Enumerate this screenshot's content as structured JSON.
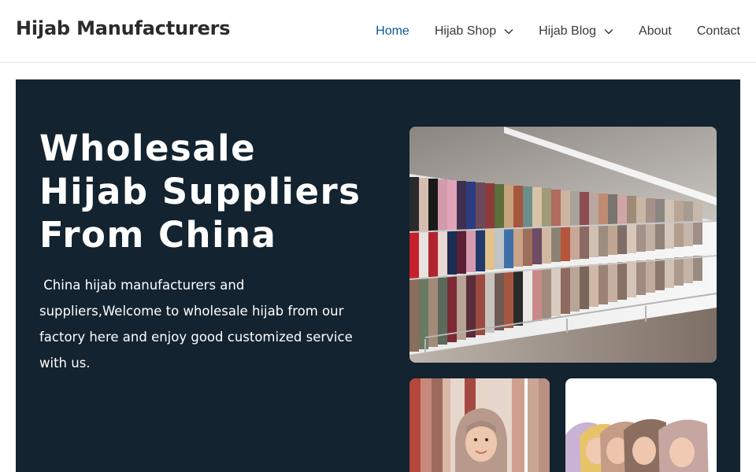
{
  "header": {
    "site_title": "Hijab Manufacturers",
    "nav": [
      {
        "label": "Home",
        "active": true,
        "has_dropdown": false
      },
      {
        "label": "Hijab Shop",
        "active": false,
        "has_dropdown": true
      },
      {
        "label": "Hijab Blog",
        "active": false,
        "has_dropdown": true
      },
      {
        "label": "About",
        "active": false,
        "has_dropdown": false
      },
      {
        "label": "Contact",
        "active": false,
        "has_dropdown": false
      }
    ]
  },
  "hero": {
    "title": "Wholesale Hijab Suppliers From China",
    "description": " China hijab manufacturers and suppliers,Welcome to wholesale hijab from our factory here and enjoy good customized service with us.",
    "images": [
      {
        "name": "hijab-store-wall-image"
      },
      {
        "name": "woman-in-hijab-image"
      },
      {
        "name": "women-in-colored-hijabs-image"
      }
    ]
  },
  "colors": {
    "accent": "#0a5a96",
    "hero_background": "#13232f",
    "text_dark": "#2b2b2b"
  }
}
